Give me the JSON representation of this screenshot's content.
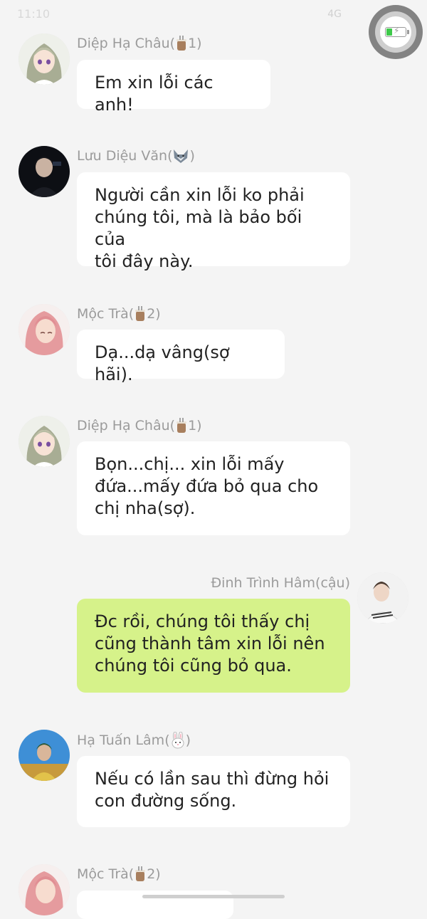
{
  "status_bar": {
    "time": "11:10",
    "signal": "4G"
  },
  "messages": [
    {
      "sender": "Diệp Hạ Châu(",
      "badge_icon": "cup-icon",
      "badge_text": "1)",
      "text": "Em xin lỗi các anh!",
      "side": "left",
      "avatar": "anime-girl-green-hair"
    },
    {
      "sender": "Lưu Diệu Văn(",
      "badge_icon": "wolf-icon",
      "badge_text": ")",
      "text": "Người cần xin lỗi ko phải\nchúng tôi, mà là bảo bối của\ntôi đây này.",
      "side": "left",
      "avatar": "man-dark-portrait"
    },
    {
      "sender": "Mộc Trà(",
      "badge_icon": "cup-icon",
      "badge_text": "2)",
      "text": "Dạ...dạ vâng(sợ hãi).",
      "side": "left",
      "avatar": "anime-girl-pink-hair"
    },
    {
      "sender": "Diệp Hạ Châu(",
      "badge_icon": "cup-icon",
      "badge_text": "1)",
      "text": "Bọn...chị... xin lỗi mấy\nđứa...mấy đứa bỏ qua cho\nchị nha(sợ).",
      "side": "left",
      "avatar": "anime-girl-green-hair"
    },
    {
      "sender": "Đinh Trình Hâm(cậu)",
      "badge_icon": "",
      "badge_text": "",
      "text": "Đc rồi, chúng tôi thấy chị\ncũng thành tâm xin lỗi nên\nchúng tôi cũng bỏ qua.",
      "side": "right",
      "avatar": "man-white-sweater"
    },
    {
      "sender": "Hạ Tuấn Lâm(",
      "badge_icon": "rabbit-icon",
      "badge_text": ")",
      "text": "Nếu có lần sau thì đừng hỏi\ncon đường sống.",
      "side": "left",
      "avatar": "boy-blue-sky"
    },
    {
      "sender": "Mộc Trà(",
      "badge_icon": "cup-icon",
      "badge_text": "2)",
      "text": "",
      "side": "left",
      "avatar": "anime-girl-pink-hair"
    }
  ],
  "colors": {
    "background": "#f4f4f4",
    "bubble_left": "#ffffff",
    "bubble_right": "#d6f28a",
    "name_text": "#9b9b9b",
    "message_text": "#222222",
    "battery_fill": "#3ec94a"
  }
}
